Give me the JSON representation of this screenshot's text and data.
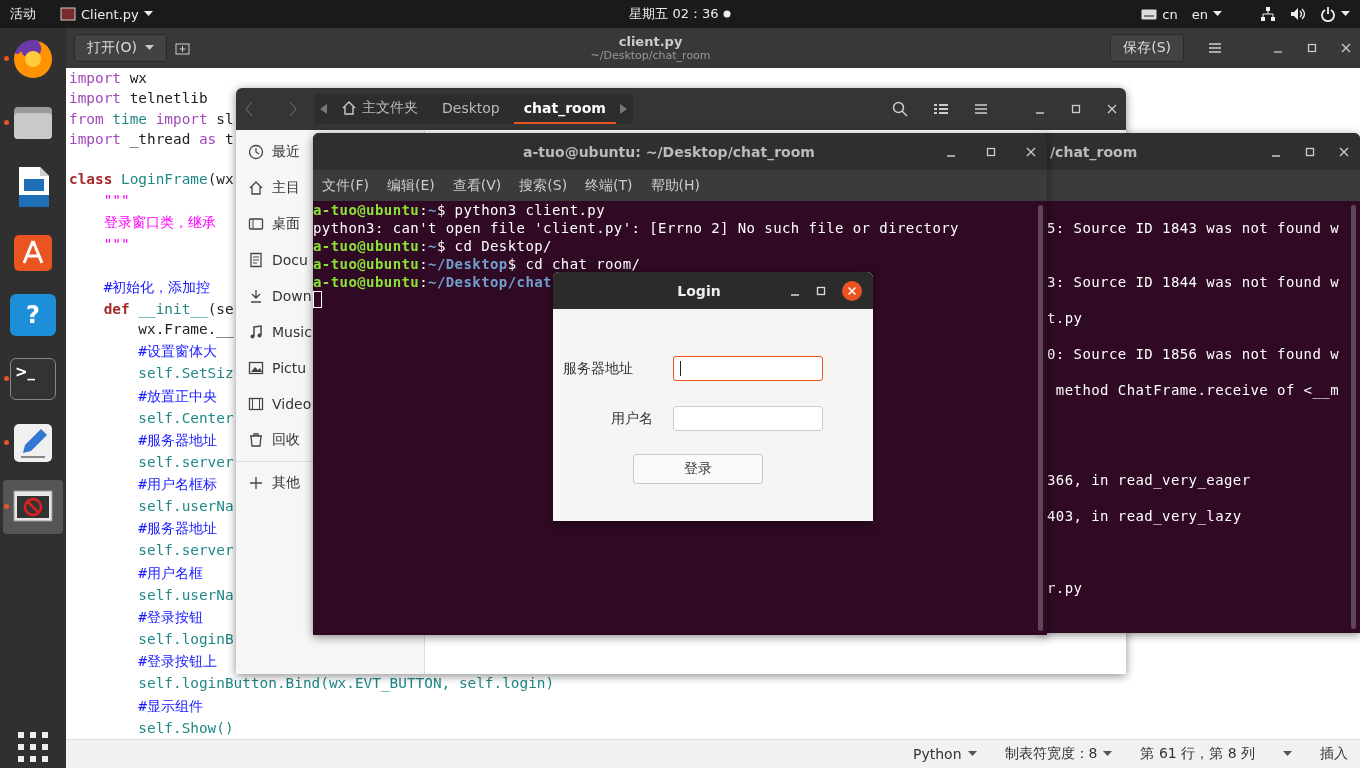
{
  "top_bar": {
    "activities": "活动",
    "app_menu": "Client.py",
    "clock": "星期五 02：36",
    "input_source": "cn",
    "language": "en"
  },
  "dock": {
    "items": [
      {
        "kind": "firefox",
        "running": true,
        "selected": false
      },
      {
        "kind": "files",
        "running": true,
        "selected": false
      },
      {
        "kind": "writer",
        "running": false,
        "selected": false
      },
      {
        "kind": "software",
        "running": false,
        "selected": false
      },
      {
        "kind": "help",
        "glyph": "?",
        "running": false,
        "selected": false
      },
      {
        "kind": "terminal",
        "glyph": ">_",
        "running": true,
        "selected": false
      },
      {
        "kind": "editor",
        "running": true,
        "selected": false
      },
      {
        "kind": "window",
        "running": true,
        "selected": true
      }
    ]
  },
  "editor": {
    "open_button": "打开(O)",
    "title": "client.py",
    "subtitle": "~/Desktop/chat_room",
    "save_button": "保存(S)",
    "lines": [
      {
        "kind": "code",
        "tokens": [
          {
            "text": "import",
            "kind": "kw"
          },
          {
            "text": " wx",
            "kind": "plain"
          }
        ]
      },
      {
        "kind": "code",
        "tokens": [
          {
            "text": "import",
            "kind": "kw"
          },
          {
            "text": " telnetlib",
            "kind": "plain"
          }
        ]
      },
      {
        "kind": "code",
        "tokens": [
          {
            "text": "from",
            "kind": "kw"
          },
          {
            "text": " time",
            "kind": "name"
          },
          {
            "text": " import",
            "kind": "kw"
          },
          {
            "text": " sl",
            "kind": "plain"
          }
        ]
      },
      {
        "kind": "code",
        "tokens": [
          {
            "text": "import",
            "kind": "kw"
          },
          {
            "text": " _thread",
            "kind": "plain"
          },
          {
            "text": " as",
            "kind": "kw"
          },
          {
            "text": " t",
            "kind": "plain"
          }
        ]
      },
      {
        "kind": "blank"
      },
      {
        "kind": "code",
        "tokens": [
          {
            "text": "class",
            "kind": "stmt"
          },
          {
            "text": " LoginFrame",
            "kind": "name"
          },
          {
            "text": "(wx",
            "kind": "plain"
          }
        ]
      },
      {
        "kind": "code",
        "tokens": [
          {
            "text": "    \"\"\"",
            "kind": "str"
          }
        ]
      },
      {
        "kind": "code",
        "tokens": [
          {
            "text": "    登录窗口类，继承",
            "kind": "str"
          }
        ]
      },
      {
        "kind": "code",
        "tokens": [
          {
            "text": "    \"\"\"",
            "kind": "str"
          }
        ]
      },
      {
        "kind": "blank"
      },
      {
        "kind": "code",
        "tokens": [
          {
            "text": "    #初始化，添加控",
            "kind": "cmt"
          }
        ]
      },
      {
        "kind": "code",
        "tokens": [
          {
            "text": "    def",
            "kind": "stmt"
          },
          {
            "text": " __init__",
            "kind": "name"
          },
          {
            "text": "(se",
            "kind": "plain"
          }
        ]
      },
      {
        "kind": "code",
        "tokens": [
          {
            "text": "        wx.Frame.__",
            "kind": "plain"
          }
        ]
      },
      {
        "kind": "code",
        "tokens": [
          {
            "text": "        #设置窗体大",
            "kind": "cmt"
          }
        ]
      },
      {
        "kind": "code",
        "tokens": [
          {
            "text": "        self.SetSiz",
            "kind": "name"
          }
        ]
      },
      {
        "kind": "code",
        "tokens": [
          {
            "text": "        #放置正中央",
            "kind": "cmt"
          }
        ]
      },
      {
        "kind": "code",
        "tokens": [
          {
            "text": "        self.Center",
            "kind": "name"
          }
        ]
      },
      {
        "kind": "code",
        "tokens": [
          {
            "text": "        #服务器地址",
            "kind": "cmt"
          }
        ]
      },
      {
        "kind": "code",
        "tokens": [
          {
            "text": "        self.server",
            "kind": "name"
          }
        ]
      },
      {
        "kind": "code",
        "tokens": [
          {
            "text": "        #用户名框标",
            "kind": "cmt"
          }
        ]
      },
      {
        "kind": "code",
        "tokens": [
          {
            "text": "        self.userNa",
            "kind": "name"
          }
        ]
      },
      {
        "kind": "code",
        "tokens": [
          {
            "text": "        #服务器地址",
            "kind": "cmt"
          }
        ]
      },
      {
        "kind": "code",
        "tokens": [
          {
            "text": "        self.server",
            "kind": "name"
          }
        ]
      },
      {
        "kind": "code",
        "tokens": [
          {
            "text": "        #用户名框",
            "kind": "cmt"
          }
        ]
      },
      {
        "kind": "code",
        "tokens": [
          {
            "text": "        self.userNa",
            "kind": "name"
          }
        ]
      },
      {
        "kind": "code",
        "tokens": [
          {
            "text": "        #登录按钮",
            "kind": "cmt"
          }
        ]
      },
      {
        "kind": "code",
        "tokens": [
          {
            "text": "        self.loginB",
            "kind": "name"
          }
        ]
      },
      {
        "kind": "code",
        "tokens": [
          {
            "text": "        #登录按钮上",
            "kind": "cmt"
          }
        ]
      },
      {
        "kind": "code",
        "tokens": [
          {
            "text": "        self.loginButton.Bind(wx.EVT_BUTTON, self.login)",
            "kind": "name"
          }
        ]
      },
      {
        "kind": "code",
        "tokens": [
          {
            "text": "        #显示组件",
            "kind": "cmt"
          }
        ]
      },
      {
        "kind": "code",
        "tokens": [
          {
            "text": "        self.Show()",
            "kind": "name"
          }
        ]
      }
    ],
    "status_bar": {
      "language": "Python",
      "tab_width": "制表符宽度：8",
      "position": "第 61 行，第 8 列",
      "mode": "插入"
    }
  },
  "file_manager": {
    "path": [
      {
        "label": "主文件夹",
        "kind": "home",
        "selected": false
      },
      {
        "label": "Desktop",
        "kind": "folder",
        "selected": false
      },
      {
        "label": "chat_room",
        "kind": "folder",
        "selected": true
      }
    ],
    "sidebar": [
      {
        "label": "最近",
        "kind": "recent"
      },
      {
        "label": "主目",
        "kind": "home"
      },
      {
        "label": "桌面",
        "kind": "desktop"
      },
      {
        "label": "Docu",
        "kind": "documents"
      },
      {
        "label": "Down",
        "kind": "downloads"
      },
      {
        "label": "Music",
        "kind": "music"
      },
      {
        "label": "Pictu",
        "kind": "pictures"
      },
      {
        "label": "Video",
        "kind": "videos"
      },
      {
        "label": "回收",
        "kind": "trash"
      },
      {
        "label": "其他",
        "kind": "other"
      }
    ]
  },
  "terminal_back": {
    "title": "/chat_room",
    "lines": [
      {
        "kind": "blank"
      },
      {
        "kind": "text",
        "text": "5: Source ID 1843 was not found w"
      },
      {
        "kind": "blank"
      },
      {
        "kind": "blank"
      },
      {
        "kind": "text",
        "text": "3: Source ID 1844 was not found w"
      },
      {
        "kind": "blank"
      },
      {
        "kind": "text",
        "text": "t.py"
      },
      {
        "kind": "blank"
      },
      {
        "kind": "text",
        "text": "0: Source ID 1856 was not found w"
      },
      {
        "kind": "blank"
      },
      {
        "kind": "text",
        "text": " method ChatFrame.receive of <__m"
      },
      {
        "kind": "blank"
      },
      {
        "kind": "blank"
      },
      {
        "kind": "blank"
      },
      {
        "kind": "blank"
      },
      {
        "kind": "text",
        "text": "366, in read_very_eager"
      },
      {
        "kind": "blank"
      },
      {
        "kind": "text",
        "text": "403, in read_very_lazy"
      },
      {
        "kind": "blank"
      },
      {
        "kind": "blank"
      },
      {
        "kind": "blank"
      },
      {
        "kind": "text",
        "text": "r.py"
      }
    ]
  },
  "terminal": {
    "title": "a-tuo@ubuntu: ~/Desktop/chat_room",
    "menu": [
      "文件(F)",
      "编辑(E)",
      "查看(V)",
      "搜索(S)",
      "终端(T)",
      "帮助(H)"
    ],
    "lines": [
      [
        {
          "text": "a-tuo@ubuntu",
          "kind": "user"
        },
        {
          "text": ":",
          "kind": "plain"
        },
        {
          "text": "~",
          "kind": "path"
        },
        {
          "text": "$ python3 client.py",
          "kind": "plain"
        }
      ],
      [
        {
          "text": "python3: can't open file 'client.py': [Errno 2] No such file or directory",
          "kind": "plain"
        }
      ],
      [
        {
          "text": "a-tuo@ubuntu",
          "kind": "user"
        },
        {
          "text": ":",
          "kind": "plain"
        },
        {
          "text": "~",
          "kind": "path"
        },
        {
          "text": "$ cd Desktop/",
          "kind": "plain"
        }
      ],
      [
        {
          "text": "a-tuo@ubuntu",
          "kind": "user"
        },
        {
          "text": ":",
          "kind": "plain"
        },
        {
          "text": "~/Desktop",
          "kind": "path"
        },
        {
          "text": "$ cd chat_room/",
          "kind": "plain"
        }
      ],
      [
        {
          "text": "a-tuo@ubuntu",
          "kind": "user"
        },
        {
          "text": ":",
          "kind": "plain"
        },
        {
          "text": "~/Desktop/chat",
          "kind": "path"
        }
      ]
    ]
  },
  "login": {
    "title": "Login",
    "fields": [
      {
        "label": "服务器地址",
        "focused": true
      },
      {
        "label": "用户名",
        "focused": false
      }
    ],
    "button": "登录"
  }
}
